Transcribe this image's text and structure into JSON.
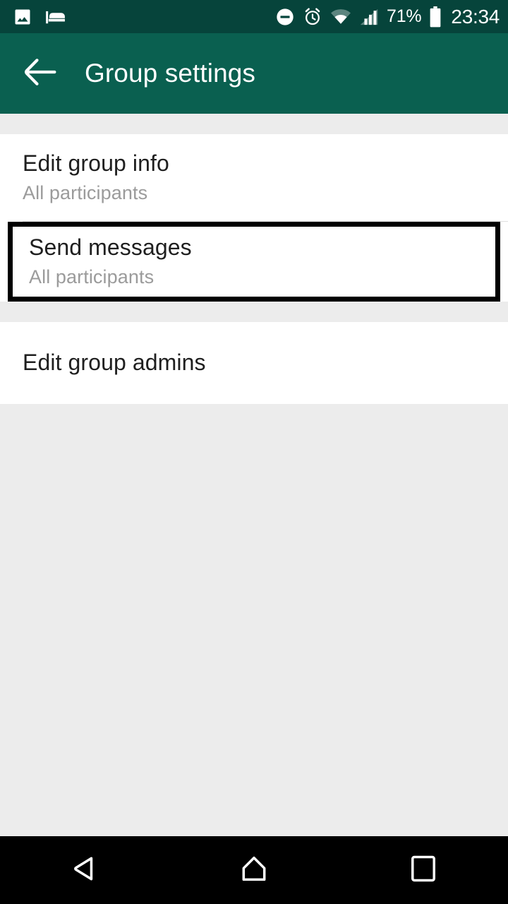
{
  "status_bar": {
    "left_icons": [
      {
        "name": "photo-icon",
        "label": "Screenshot saved"
      },
      {
        "name": "bed-icon",
        "label": "Sleep mode"
      }
    ],
    "right_icons": [
      {
        "name": "do-not-disturb-icon",
        "label": "Do not disturb"
      },
      {
        "name": "alarm-icon",
        "label": "Alarm set"
      },
      {
        "name": "wifi-icon",
        "label": "Wi-Fi connected"
      },
      {
        "name": "cellular-signal-icon",
        "label": "Signal strength"
      }
    ],
    "battery_percent": "71%",
    "battery_icon": "battery-icon",
    "clock": "23:34",
    "background_color": "#06443b",
    "foreground_color": "#ffffff"
  },
  "app_bar": {
    "back_icon": "back-arrow-icon",
    "title": "Group settings",
    "background_color": "#0a6050",
    "text_color": "#ffffff"
  },
  "sections": [
    {
      "items": [
        {
          "name": "edit-group-info",
          "title": "Edit group info",
          "subtitle": "All participants",
          "highlighted": false
        },
        {
          "name": "send-messages",
          "title": "Send messages",
          "subtitle": "All participants",
          "highlighted": true
        }
      ]
    },
    {
      "items": [
        {
          "name": "edit-group-admins",
          "title": "Edit group admins",
          "subtitle": "",
          "highlighted": false
        }
      ]
    }
  ],
  "highlight": {
    "border_color": "#000000",
    "border_width_px": 7
  },
  "nav_bar": {
    "background_color": "#000000",
    "buttons": [
      {
        "name": "nav-back-button",
        "icon": "back-triangle-icon"
      },
      {
        "name": "nav-home-button",
        "icon": "home-icon"
      },
      {
        "name": "nav-recents-button",
        "icon": "square-recents-icon"
      }
    ]
  },
  "colors": {
    "page_background": "#ececec",
    "card_background": "#ffffff",
    "primary_text": "#1f1f1f",
    "secondary_text": "#9b9b9b",
    "divider": "#e0e0e0"
  }
}
